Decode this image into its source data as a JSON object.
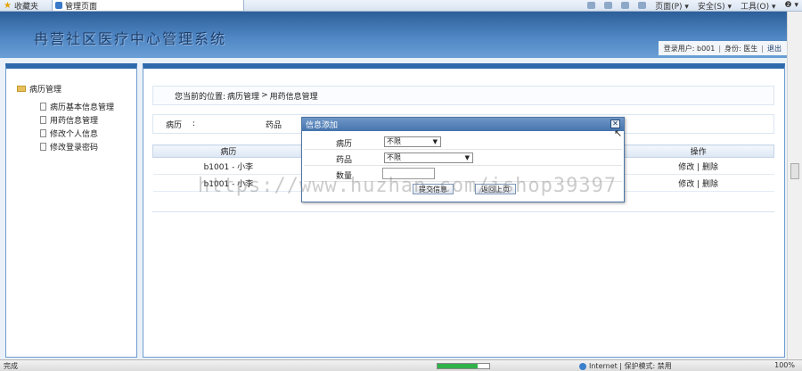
{
  "browser": {
    "favorites_label": "收藏夹",
    "tab_title": "管理页面",
    "toolbar": {
      "page_menu": "页面(P) ▾",
      "safety_menu": "安全(S) ▾",
      "tools_menu": "工具(O) ▾",
      "help_menu": "❷ ▾"
    },
    "status_text": "完成",
    "zone_text": "Internet | 保护模式: 禁用",
    "zoom_text": "100%",
    "progress_percent": 78
  },
  "header": {
    "title": "冉营社区医疗中心管理系统",
    "user_label": "登录用户: b001",
    "role_label": "身份: 医生",
    "separator": "|",
    "logout_label": "退出"
  },
  "sidebar": {
    "root_label": "病历管理",
    "items": [
      {
        "label": "病历基本信息管理"
      },
      {
        "label": "用药信息管理"
      },
      {
        "label": "修改个人信息"
      },
      {
        "label": "修改登录密码"
      }
    ]
  },
  "main": {
    "breadcrumb_prefix": "您当前的位置:",
    "breadcrumb_parent": "病历管理",
    "breadcrumb_sep": ">",
    "breadcrumb_current": "用药信息管理",
    "filter": {
      "record_label": "病历",
      "colon": ":",
      "drug_label": "药品"
    },
    "table": {
      "headers": [
        "病历",
        "操作"
      ],
      "rows": [
        {
          "record": "b1001 - 小李",
          "edit": "修改",
          "sep": "|",
          "delete": "删除"
        },
        {
          "record": "b1001 - 小李",
          "edit": "修改",
          "sep": "|",
          "delete": "删除"
        }
      ]
    }
  },
  "dialog": {
    "title": "信息添加",
    "close_glyph": "✕",
    "fields": [
      {
        "label": "病历",
        "value": "不限"
      },
      {
        "label": "药品",
        "value": "不限"
      },
      {
        "label": "数量",
        "value": ""
      }
    ],
    "submit_label": "提交信息",
    "back_label": "返回上页"
  },
  "watermark": "https://www.huzhan.com/ishop39397"
}
